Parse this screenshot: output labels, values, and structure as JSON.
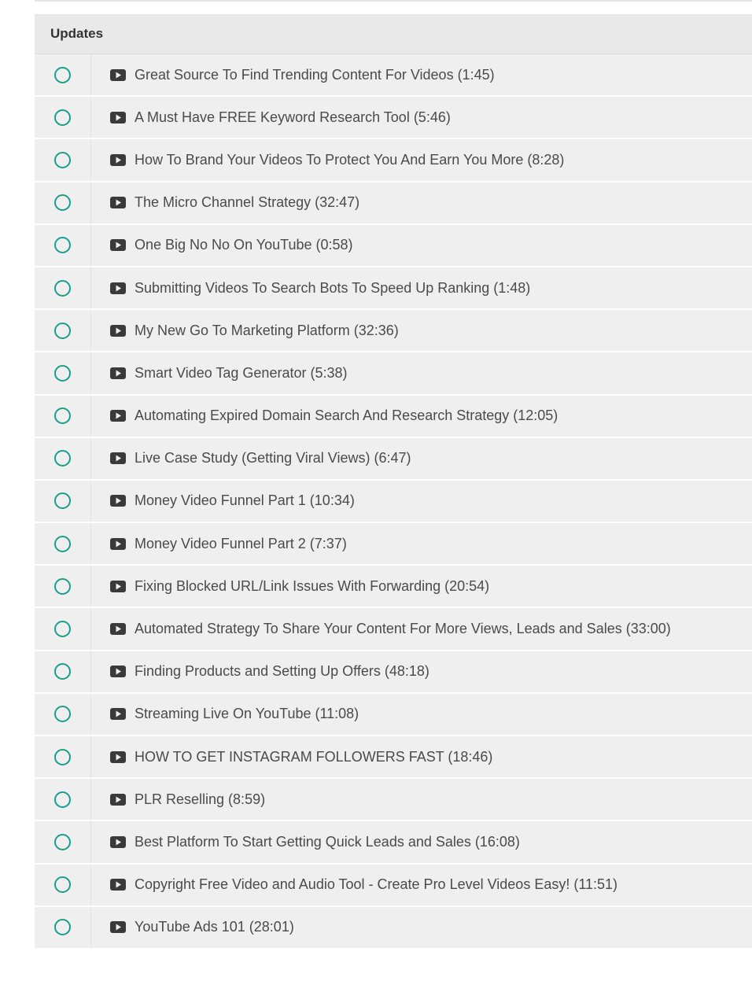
{
  "section": {
    "title": "Updates",
    "lectures": [
      {
        "label": "Great Source To Find Trending Content For Videos (1:45)"
      },
      {
        "label": "A Must Have FREE Keyword Research Tool (5:46)"
      },
      {
        "label": "How To Brand Your Videos To Protect You And Earn You More (8:28)"
      },
      {
        "label": "The Micro Channel Strategy (32:47)"
      },
      {
        "label": "One Big No No On YouTube (0:58)"
      },
      {
        "label": "Submitting Videos To Search Bots To Speed Up Ranking (1:48)"
      },
      {
        "label": "My New Go To Marketing Platform (32:36)"
      },
      {
        "label": "Smart Video Tag Generator (5:38)"
      },
      {
        "label": "Automating Expired Domain Search And Research Strategy (12:05)"
      },
      {
        "label": "Live Case Study (Getting Viral Views) (6:47)"
      },
      {
        "label": "Money Video Funnel Part 1 (10:34)"
      },
      {
        "label": "Money Video Funnel Part 2 (7:37)"
      },
      {
        "label": "Fixing Blocked URL/Link Issues With Forwarding (20:54)"
      },
      {
        "label": "Automated Strategy To Share Your Content For More Views, Leads and Sales (33:00)"
      },
      {
        "label": "Finding Products and Setting Up Offers (48:18)"
      },
      {
        "label": "Streaming Live On YouTube (11:08)"
      },
      {
        "label": "HOW TO GET INSTAGRAM FOLLOWERS FAST (18:46)"
      },
      {
        "label": "PLR Reselling (8:59)"
      },
      {
        "label": "Best Platform To Start Getting Quick Leads and Sales (16:08)"
      },
      {
        "label": "Copyright Free Video and Audio Tool - Create Pro Level Videos Easy! (11:51)"
      },
      {
        "label": "YouTube Ads 101 (28:01)"
      }
    ]
  },
  "icons": {
    "status": "incomplete-circle-icon",
    "type": "play-video-icon"
  },
  "colors": {
    "accent": "#1a9e8c",
    "row_background": "#efefef",
    "header_background": "#e9e9e9",
    "text": "#4a4a4a"
  }
}
